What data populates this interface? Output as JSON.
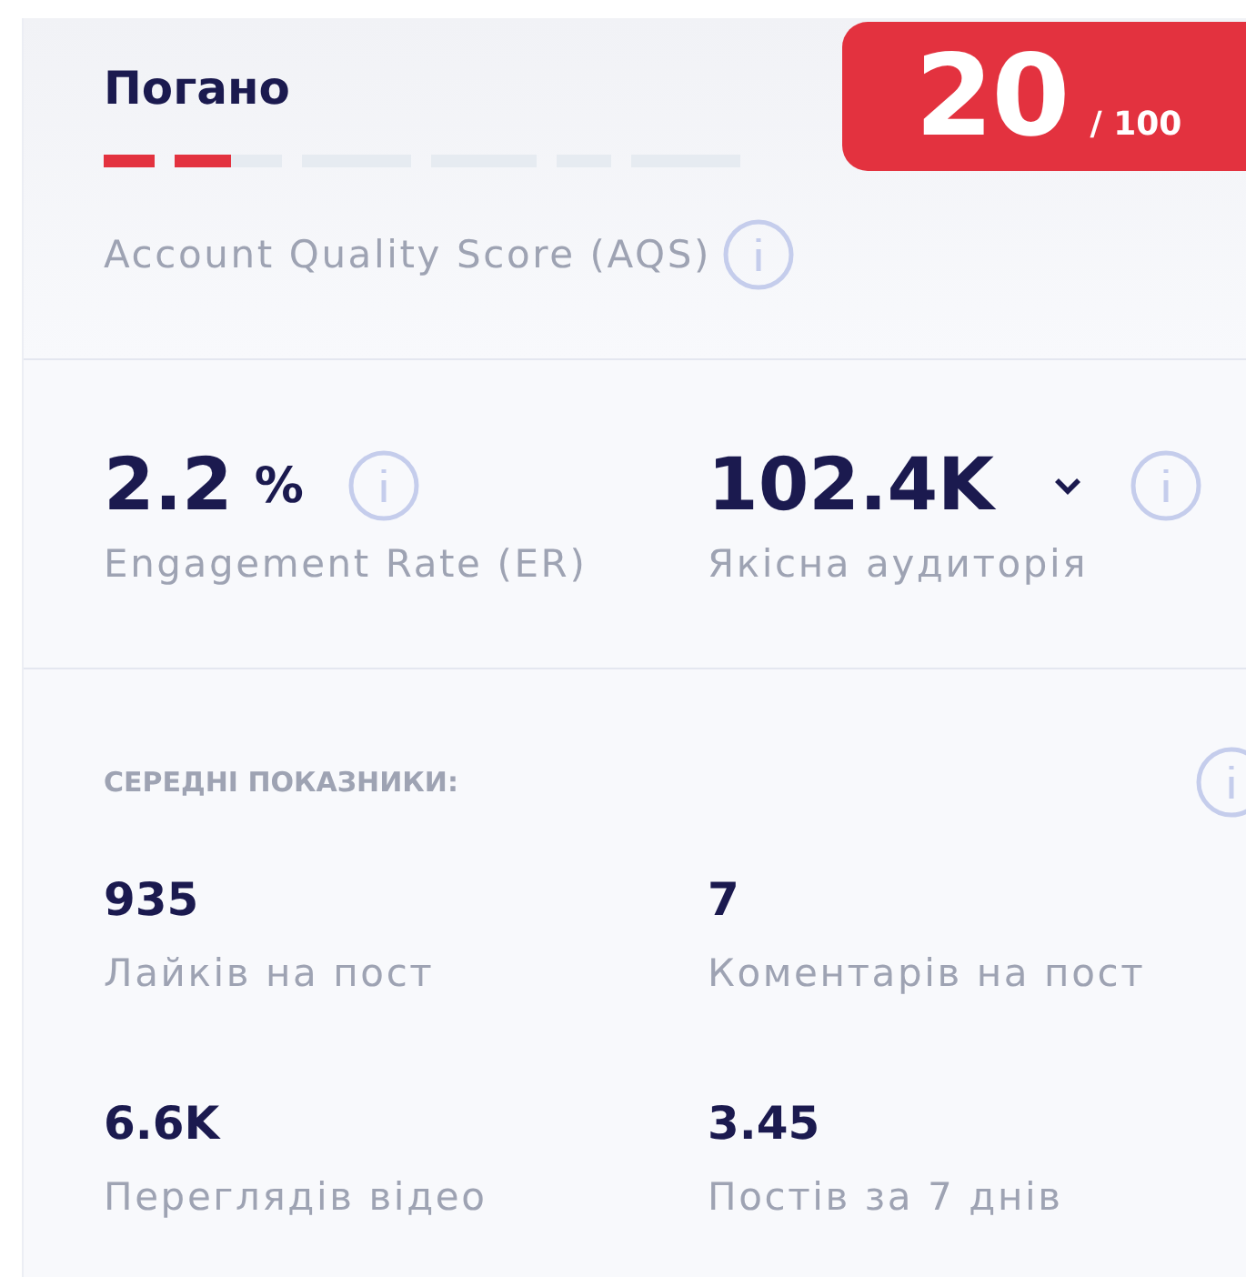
{
  "rating": {
    "label": "Погано",
    "level": 0.2,
    "score": "20",
    "score_max": "/ 100"
  },
  "aqs": {
    "label": "Account Quality Score (AQS)"
  },
  "key_metrics": [
    {
      "value": "2.2",
      "unit": "%",
      "label": "Engagement Rate (ER)",
      "dropdown": false
    },
    {
      "value": "102.4K",
      "label": "Якісна аудиторія",
      "dropdown": true
    }
  ],
  "averages": {
    "title": "СЕРЕДНІ ПОКАЗНИКИ:",
    "items": [
      {
        "value": "935",
        "label": "Лайків на пост"
      },
      {
        "value": "7",
        "label": "Коментарів на пост"
      },
      {
        "value": "6.6K",
        "label": "Переглядів відео"
      },
      {
        "value": "3.45",
        "label": "Постів за 7 днів"
      }
    ]
  }
}
